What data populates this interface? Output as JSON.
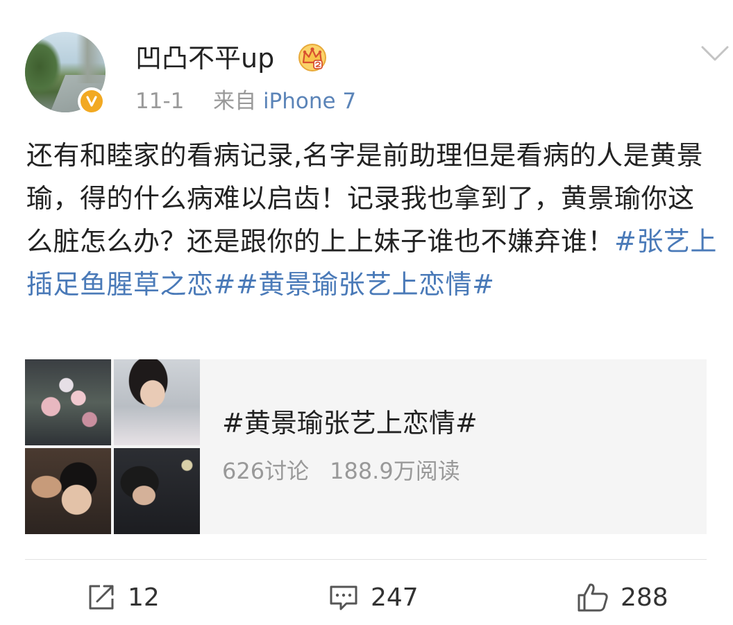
{
  "author": {
    "name": "凹凸不平up",
    "date": "11-1",
    "source_prefix": "来自",
    "source_device": "iPhone 7"
  },
  "post": {
    "text_plain": "还有和睦家的看病记录,名字是前助理但是看病的人是黄景瑜，得的什么病难以启齿！记录我也拿到了，黄景瑜你这么脏怎么办？还是跟你的上上妹子谁也不嫌弃谁！",
    "hashtag_1": "#张艺上插足鱼腥草之恋#",
    "hashtag_2": "#黄景瑜张艺上恋情#"
  },
  "topic_card": {
    "title": "#黄景瑜张艺上恋情#",
    "discussions": "626讨论",
    "reads": "188.9万阅读"
  },
  "actions": {
    "reposts": "12",
    "comments": "247",
    "likes": "288"
  },
  "colors": {
    "link": "#4a7ab8",
    "meta_gray": "#999999",
    "verified_badge": "#f2a922",
    "card_bg": "#f5f5f5"
  }
}
